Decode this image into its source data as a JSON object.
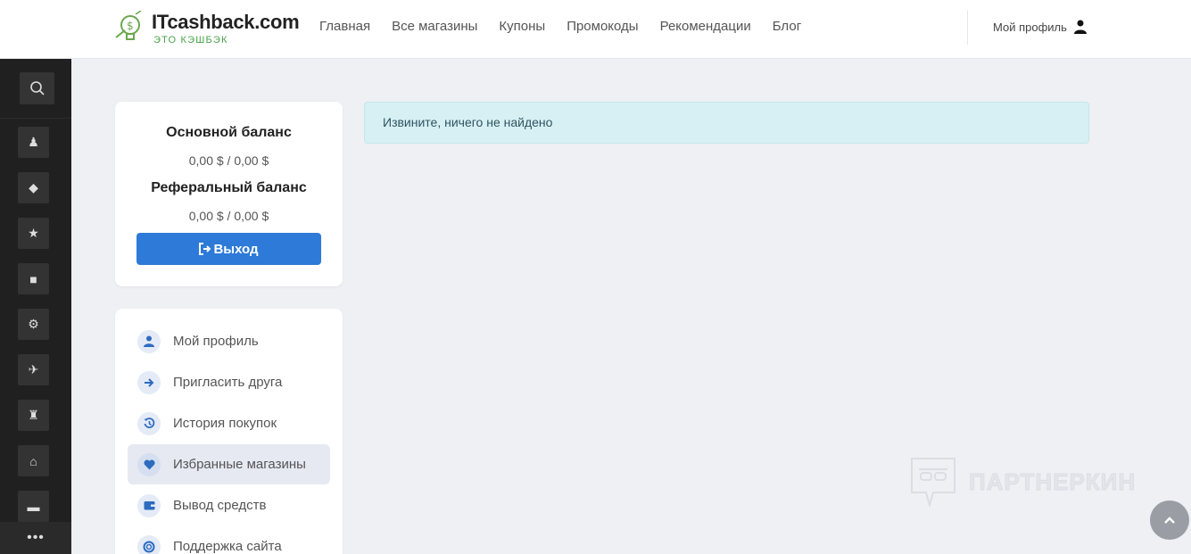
{
  "header": {
    "logo_text": "ITcashback.com",
    "logo_subtitle": "ЭТО КЭШБЭК",
    "nav": [
      "Главная",
      "Все магазины",
      "Купоны",
      "Промокоды",
      "Рекомендации",
      "Блог"
    ],
    "profile_label": "Мой профиль"
  },
  "sidebar": {
    "icons": [
      "search-icon",
      "person-icon",
      "diamond-icon",
      "star-icon",
      "camera-icon",
      "gears-icon",
      "plane-icon",
      "figure-icon",
      "home-icon",
      "car-icon"
    ],
    "more_icon": "ellipsis-icon"
  },
  "balance": {
    "main_title": "Основной баланс",
    "main_value": "0,00 $ / 0,00 $",
    "ref_title": "Реферальный баланс",
    "ref_value": "0,00 $ / 0,00 $",
    "logout_label": "Выход"
  },
  "menu": {
    "items": [
      {
        "label": "Мой профиль",
        "icon": "user-icon"
      },
      {
        "label": "Пригласить друга",
        "icon": "arrow-right-icon"
      },
      {
        "label": "История покупок",
        "icon": "history-icon"
      },
      {
        "label": "Избранные магазины",
        "icon": "heart-icon",
        "active": true
      },
      {
        "label": "Вывод средств",
        "icon": "wallet-icon"
      },
      {
        "label": "Поддержка сайта",
        "icon": "support-icon"
      }
    ]
  },
  "alert": {
    "text": "Извините, ничего не найдено"
  },
  "watermark": {
    "text": "ПАРТНЕРКИН"
  },
  "colors": {
    "accent": "#2d7ad8",
    "sidebar_bg": "#202020",
    "alert_bg": "#d7f0f4",
    "logo_green": "#4aa24a"
  }
}
